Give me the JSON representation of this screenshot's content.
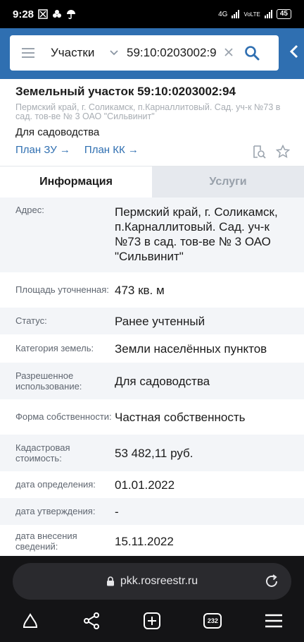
{
  "status_bar": {
    "time": "9:28",
    "network": "4G",
    "network2": "VoLTE",
    "battery": "45"
  },
  "search": {
    "category": "Участки",
    "query": "59:10:0203002:9"
  },
  "parcel": {
    "title": "Земельный участок 59:10:0203002:94",
    "address_short": "Пермский край, г. Соликамск, п.Карналлитовый. Сад. уч-к №73 в сад. тов-ве № 3 ОАО \"Сильвинит\"",
    "purpose": "Для садоводства",
    "link_plan_zu": "План ЗУ",
    "link_plan_kk": "План КК"
  },
  "tabs": {
    "info": "Информация",
    "services": "Услуги"
  },
  "info_rows": [
    {
      "label": "Адрес:",
      "value": "Пермский край, г. Соликамск, п.Карналлитовый. Сад. уч-к №73 в сад. тов-ве № 3 ОАО \"Сильвинит\""
    },
    {
      "label": "Площадь уточненная:",
      "value": "473 кв. м"
    },
    {
      "label": "Статус:",
      "value": "Ранее учтенный"
    },
    {
      "label": "Категория земель:",
      "value": "Земли населённых пунктов"
    },
    {
      "label": "Разрешенное использование:",
      "value": "Для садоводства"
    },
    {
      "label": "Форма собственности:",
      "value": "Частная собственность"
    },
    {
      "label": "Кадастровая стоимость:",
      "value": "53 482,11 руб."
    },
    {
      "label": "дата определения:",
      "value": "01.01.2022"
    },
    {
      "label": "дата утверждения:",
      "value": "-"
    },
    {
      "label": "дата внесения сведений:",
      "value": "15.11.2022"
    }
  ],
  "browser": {
    "url": "pkk.rosreestr.ru",
    "tab_count": "232"
  },
  "icons": {
    "search": "search-icon",
    "clear": "close-icon",
    "menu": "hamburger-icon",
    "collapse": "chevron-left-icon",
    "doc_search": "document-search-icon",
    "star": "star-icon",
    "lock": "lock-icon",
    "reload": "reload-icon",
    "home": "home-icon",
    "share": "share-icon",
    "new_tab": "add-tab-icon",
    "menu_bottom": "menu-icon"
  },
  "colors": {
    "accent": "#2f6fb1",
    "tab_inactive_bg": "#e6e9ee"
  }
}
